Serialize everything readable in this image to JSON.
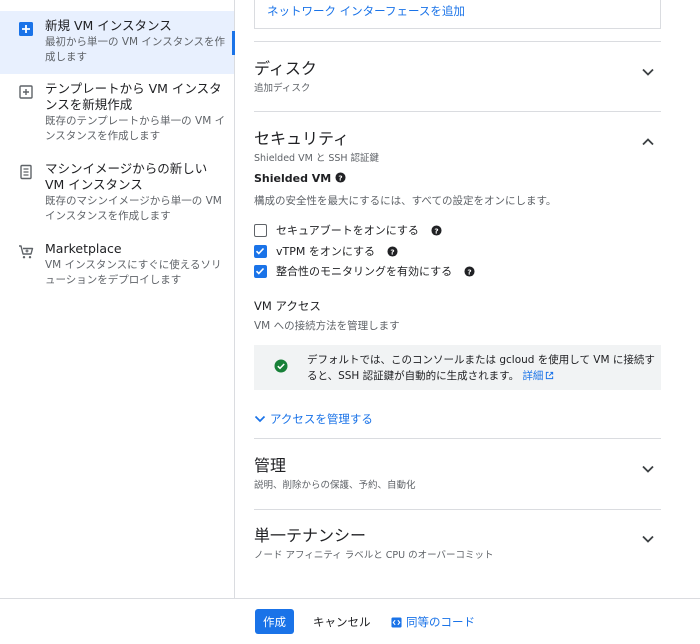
{
  "sidebar": {
    "items": [
      {
        "title": "新規 VM インスタンス",
        "desc": "最初から単一の VM インスタンスを作成します",
        "icon": "plus-box-icon",
        "active": true
      },
      {
        "title": "テンプレートから VM インスタンスを新規作成",
        "desc": "既存のテンプレートから単一の VM インスタンスを作成します",
        "icon": "template-plus-icon",
        "active": false
      },
      {
        "title": "マシンイメージからの新しい VM インスタンス",
        "desc": "既存のマシンイメージから単一の VM インスタンスを作成します",
        "icon": "machine-image-icon",
        "active": false
      },
      {
        "title": "Marketplace",
        "desc": "VM インスタンスにすぐに使えるソリューションをデプロイします",
        "icon": "cart-icon",
        "active": false
      }
    ]
  },
  "network": {
    "add_interface_link": "ネットワーク インターフェースを追加"
  },
  "disk": {
    "title": "ディスク",
    "subtitle": "追加ディスク"
  },
  "security": {
    "title": "セキュリティ",
    "subtitle": "Shielded VM と SSH 認証鍵",
    "shielded_label": "Shielded VM",
    "shielded_desc": "構成の安全性を最大にするには、すべての設定をオンにします。",
    "options": [
      {
        "label": "セキュアブートをオンにする",
        "checked": false
      },
      {
        "label": "vTPM をオンにする",
        "checked": true
      },
      {
        "label": "整合性のモニタリングを有効にする",
        "checked": true
      }
    ],
    "vm_access_label": "VM アクセス",
    "vm_access_desc": "VM への接続方法を管理します",
    "info_text": "デフォルトでは、このコンソールまたは gcloud を使用して VM に接続すると、SSH 認証鍵が自動的に生成されます。",
    "info_link": "詳細",
    "manage_access_link": "アクセスを管理する"
  },
  "management": {
    "title": "管理",
    "subtitle": "説明、削除からの保護、予約、自動化"
  },
  "sole_tenancy": {
    "title": "単一テナンシー",
    "subtitle": "ノード アフィニティ ラベルと CPU のオーバーコミット"
  },
  "footer": {
    "create_label": "作成",
    "cancel_label": "キャンセル",
    "code_label": "同等のコード"
  },
  "colors": {
    "accent": "#1a73e8",
    "active_bg": "#e8f0fe",
    "info_bg": "#f1f3f4",
    "success": "#188038"
  }
}
